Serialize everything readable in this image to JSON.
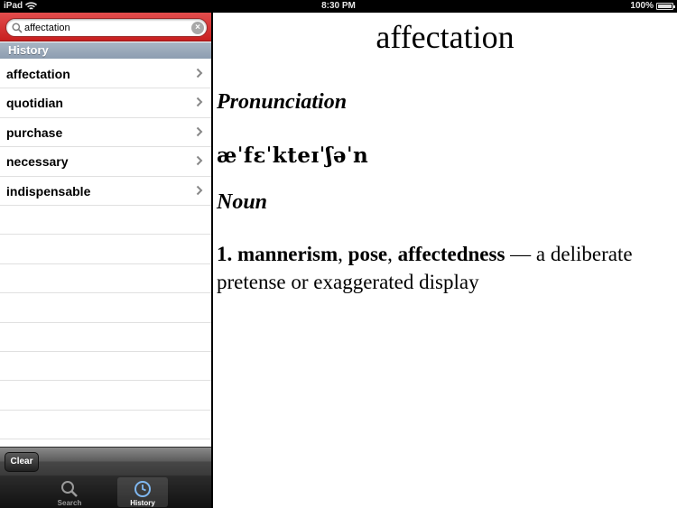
{
  "status_bar": {
    "carrier": "iPad",
    "time": "8:30 PM",
    "battery": "100%"
  },
  "search": {
    "value": "affectation",
    "placeholder": ""
  },
  "history": {
    "header": "History",
    "items": [
      "affectation",
      "quotidian",
      "purchase",
      "necessary",
      "indispensable"
    ]
  },
  "toolbar": {
    "clear_label": "Clear"
  },
  "tabs": [
    {
      "label": "Search",
      "icon": "search-icon"
    },
    {
      "label": "History",
      "icon": "clock-icon",
      "selected": true
    }
  ],
  "entry": {
    "word": "affectation",
    "pronunciation_heading": "Pronunciation",
    "ipa": "æˈfɛˈkteɪˈʃəˈn",
    "part_of_speech": "Noun",
    "definition": {
      "number": "1.",
      "synonyms": [
        "mannerism",
        "pose",
        "affectedness"
      ],
      "separator": ", ",
      "dash": "—",
      "text": "a deliberate pretense or exaggerated display"
    }
  },
  "colors": {
    "search_bar": "#d83434",
    "section_header": "#98a8b9",
    "tab_bar": "#1e1e1e"
  }
}
